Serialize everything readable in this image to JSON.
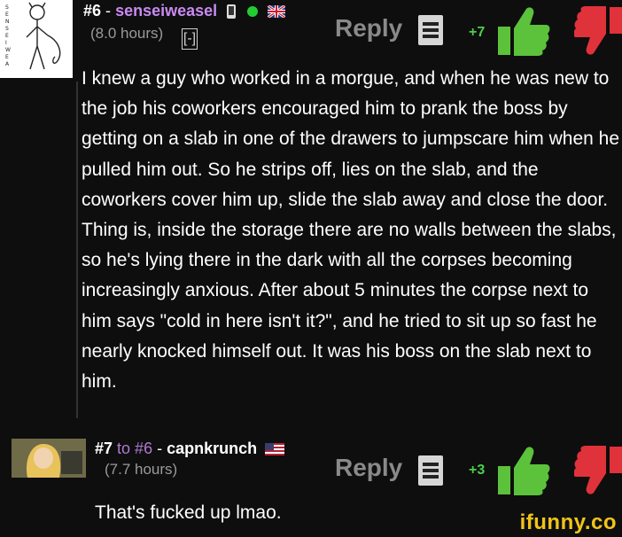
{
  "comments": [
    {
      "number": "#6",
      "separator": "-",
      "username": "senseiweasel",
      "time": "(8.0 hours)",
      "collapse": "[-]",
      "reply_label": "Reply",
      "score": "+7",
      "text": "I knew a guy who worked in a morgue, and when he was new to the job his coworkers encouraged him to prank the boss by getting on a slab in one of the drawers to jumpscare him when he pulled him out. So he strips off, lies on the slab, and the coworkers cover him up, slide the slab away and close the door. Thing is, inside the storage there are no walls between the slabs, so he's lying there in the dark with all the corpses becoming increasingly anxious. After about 5 minutes the corpse next to him says \"cold in here isn't it?\", and he tried to sit up so fast he nearly knocked himself out. It was his boss on the slab next to him.",
      "avatar_text": "SENSEIWEASEL",
      "icons": [
        "mobile-icon",
        "online-dot-icon",
        "uk-flag-icon"
      ]
    },
    {
      "number": "#7",
      "to": "to #6",
      "separator": "-",
      "username": "capnkrunch",
      "time": "(7.7 hours)",
      "reply_label": "Reply",
      "score": "+3",
      "text": "That's fucked up lmao.",
      "icons": [
        "us-flag-icon"
      ]
    }
  ],
  "watermark": "ifunny.co",
  "colors": {
    "background": "#0e0e0e",
    "username_c1": "#c98af2",
    "to_link": "#b07ad0",
    "score": "#4ad04a",
    "thumb_up": "#5cc23b",
    "thumb_down": "#e0323a",
    "watermark": "#f0c419"
  }
}
